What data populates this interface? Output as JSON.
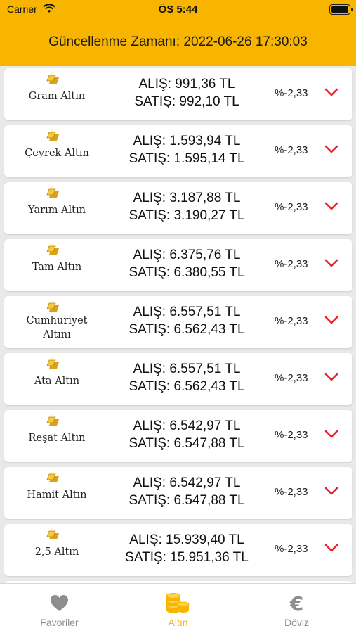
{
  "status_bar": {
    "carrier": "Carrier",
    "time": "ÖS 5:44"
  },
  "header": {
    "update_time": "Güncellenme Zamanı: 2022-06-26 17:30:03"
  },
  "colors": {
    "accent": "#f7b500",
    "down_arrow": "#e8232a",
    "tab_active": "#f7b500",
    "tab_inactive": "#8e8e8e"
  },
  "items": [
    {
      "name": "Gram Altın",
      "buy": "ALIŞ: 991,36 TL",
      "sell": "SATIŞ: 992,10 TL",
      "change": "%-2,33",
      "trend_icon": "chevron-down-icon"
    },
    {
      "name": "Çeyrek Altın",
      "buy": "ALIŞ: 1.593,94 TL",
      "sell": "SATIŞ: 1.595,14 TL",
      "change": "%-2,33",
      "trend_icon": "chevron-down-icon"
    },
    {
      "name": "Yarım Altın",
      "buy": "ALIŞ: 3.187,88 TL",
      "sell": "SATIŞ: 3.190,27 TL",
      "change": "%-2,33",
      "trend_icon": "chevron-down-icon"
    },
    {
      "name": "Tam Altın",
      "buy": "ALIŞ: 6.375,76 TL",
      "sell": "SATIŞ: 6.380,55 TL",
      "change": "%-2,33",
      "trend_icon": "chevron-down-icon"
    },
    {
      "name": "Cumhuriyet Altını",
      "buy": "ALIŞ: 6.557,51 TL",
      "sell": "SATIŞ: 6.562,43 TL",
      "change": "%-2,33",
      "trend_icon": "chevron-down-icon"
    },
    {
      "name": "Ata Altın",
      "buy": "ALIŞ: 6.557,51 TL",
      "sell": "SATIŞ: 6.562,43 TL",
      "change": "%-2,33",
      "trend_icon": "chevron-down-icon"
    },
    {
      "name": "Reşat Altın",
      "buy": "ALIŞ: 6.542,97 TL",
      "sell": "SATIŞ: 6.547,88 TL",
      "change": "%-2,33",
      "trend_icon": "chevron-down-icon"
    },
    {
      "name": "Hamit Altın",
      "buy": "ALIŞ: 6.542,97 TL",
      "sell": "SATIŞ: 6.547,88 TL",
      "change": "%-2,33",
      "trend_icon": "chevron-down-icon"
    },
    {
      "name": "2,5 Altın",
      "buy": "ALIŞ: 15.939,40 TL",
      "sell": "SATIŞ: 15.951,36 TL",
      "change": "%-2,33",
      "trend_icon": "chevron-down-icon"
    }
  ],
  "tabs": [
    {
      "label": "Favoriler",
      "icon": "heart-icon",
      "active": false
    },
    {
      "label": "Altın",
      "icon": "coins-icon",
      "active": true
    },
    {
      "label": "Döviz",
      "icon": "euro-icon",
      "active": false
    }
  ]
}
